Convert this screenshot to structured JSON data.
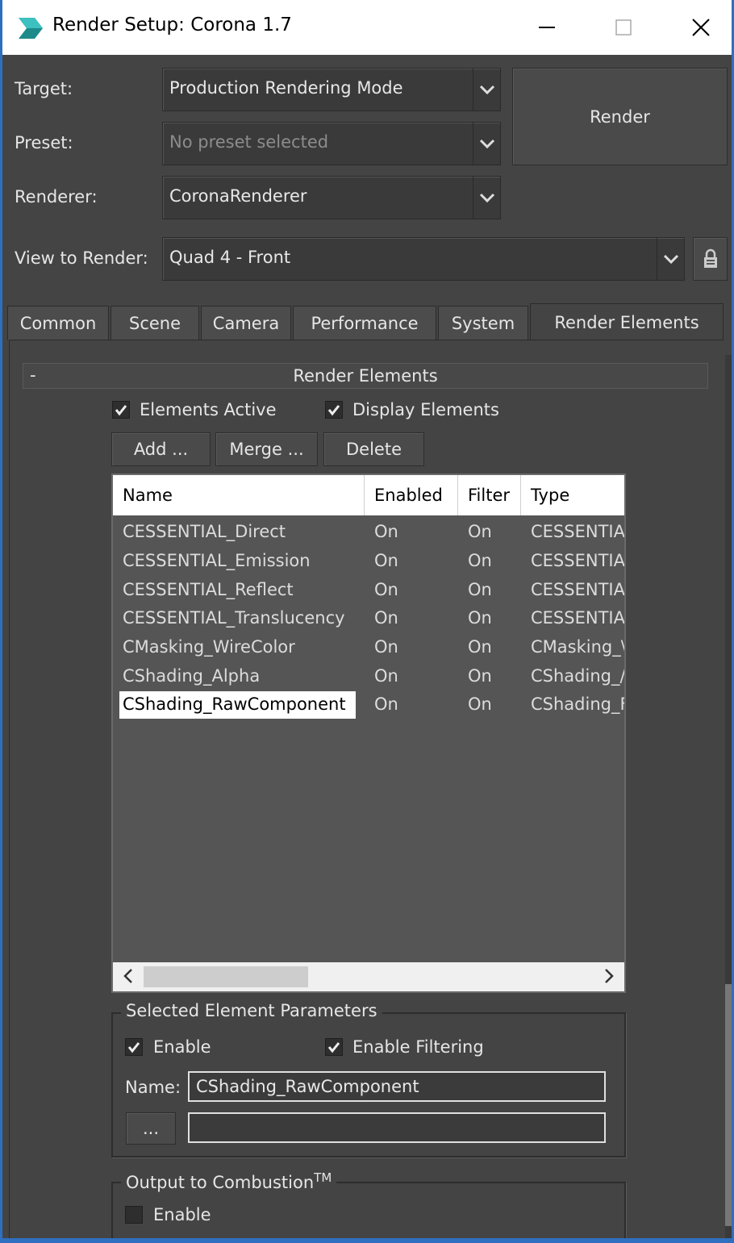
{
  "window": {
    "title": "Render Setup: Corona 1.7",
    "accent_color": "#2f6fbf"
  },
  "target": {
    "label": "Target:",
    "value": "Production Rendering Mode"
  },
  "preset": {
    "label": "Preset:",
    "placeholder": "No preset selected"
  },
  "renderer": {
    "label": "Renderer:",
    "value": "CoronaRenderer"
  },
  "view_to_render": {
    "label": "View to Render:",
    "value": "Quad 4 - Front"
  },
  "render_button": {
    "label": "Render"
  },
  "tabs": [
    {
      "label": "Common"
    },
    {
      "label": "Scene"
    },
    {
      "label": "Camera"
    },
    {
      "label": "Performance"
    },
    {
      "label": "System"
    },
    {
      "label": "Render Elements"
    }
  ],
  "rollout": {
    "collapse_symbol": "-",
    "title": "Render Elements",
    "elements_active_label": "Elements Active",
    "display_elements_label": "Display Elements",
    "add_label": "Add ...",
    "merge_label": "Merge ...",
    "delete_label": "Delete"
  },
  "table": {
    "columns": [
      "Name",
      "Enabled",
      "Filter",
      "Type"
    ],
    "rows": [
      {
        "name": "CESSENTIAL_Direct",
        "enabled": "On",
        "filter": "On",
        "type": "CESSENTIA"
      },
      {
        "name": "CESSENTIAL_Emission",
        "enabled": "On",
        "filter": "On",
        "type": "CESSENTIA"
      },
      {
        "name": "CESSENTIAL_Reflect",
        "enabled": "On",
        "filter": "On",
        "type": "CESSENTIA"
      },
      {
        "name": "CESSENTIAL_Translucency",
        "enabled": "On",
        "filter": "On",
        "type": "CESSENTIA"
      },
      {
        "name": "CMasking_WireColor",
        "enabled": "On",
        "filter": "On",
        "type": "CMasking_\\"
      },
      {
        "name": "CShading_Alpha",
        "enabled": "On",
        "filter": "On",
        "type": "CShading_/"
      },
      {
        "name": "CShading_RawComponent",
        "enabled": "On",
        "filter": "On",
        "type": "CShading_F"
      }
    ],
    "selected_row": 6
  },
  "selected_params": {
    "title": "Selected Element Parameters",
    "enable_label": "Enable",
    "enable_filtering_label": "Enable Filtering",
    "name_label": "Name:",
    "name_value": "CShading_RawComponent",
    "browse_label": "...",
    "path_value": ""
  },
  "combustion": {
    "title": "Output to Combustion",
    "title_sup": "TM",
    "enable_label": "Enable"
  }
}
